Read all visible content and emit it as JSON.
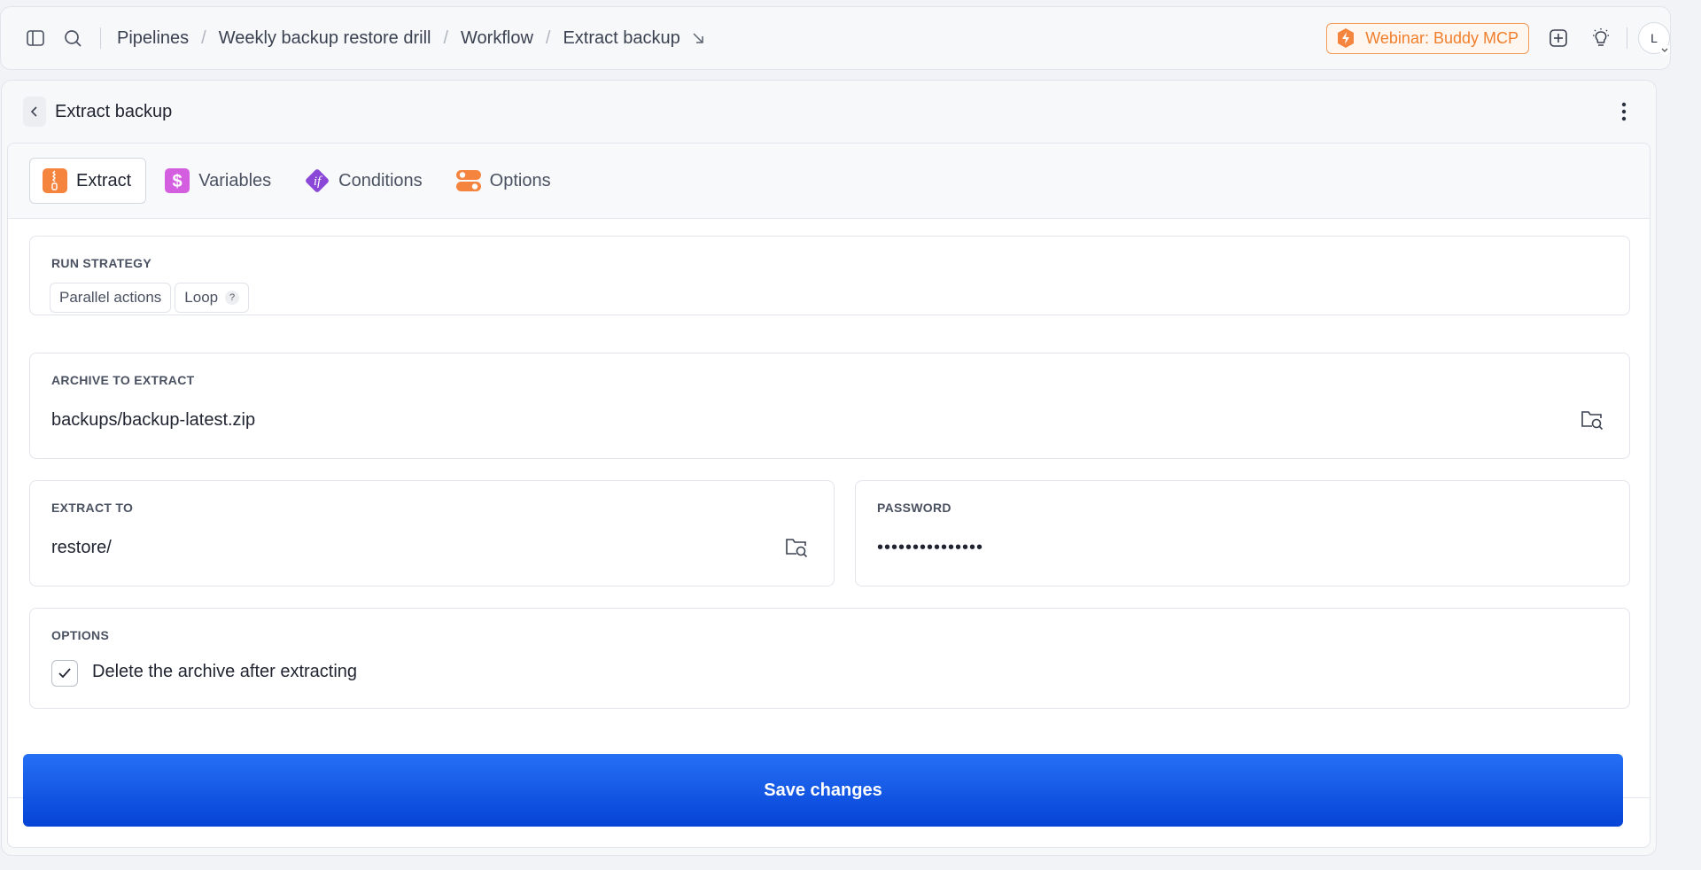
{
  "breadcrumb": [
    "Pipelines",
    "Weekly backup restore drill",
    "Workflow",
    "Extract backup"
  ],
  "header": {
    "webinar_label": "Webinar: Buddy MCP",
    "avatar_initial": "L"
  },
  "panel": {
    "title": "Extract backup"
  },
  "tabs": [
    {
      "label": "Extract",
      "icon": "zip-icon",
      "active": true
    },
    {
      "label": "Variables",
      "icon": "dollar-icon"
    },
    {
      "label": "Conditions",
      "icon": "if-icon"
    },
    {
      "label": "Options",
      "icon": "toggles-icon"
    }
  ],
  "run_strategy": {
    "label": "RUN STRATEGY",
    "chips": [
      "Parallel actions",
      "Loop"
    ],
    "help": "?"
  },
  "archive": {
    "label": "ARCHIVE TO EXTRACT",
    "value": "backups/backup-latest.zip"
  },
  "extract_to": {
    "label": "EXTRACT TO",
    "value": "restore/"
  },
  "password": {
    "label": "PASSWORD",
    "value": "•••••••••••••••"
  },
  "options": {
    "label": "OPTIONS",
    "delete_after_label": "Delete the archive after extracting",
    "delete_after_checked": true
  },
  "save_label": "Save changes",
  "colors": {
    "accent": "#0a55e8",
    "webinar": "#f07e2c",
    "tab_extract": "#f5843f",
    "tab_variables": "#d35fe0",
    "tab_conditions": "#8a47d8",
    "tab_options": "#f5843f"
  }
}
